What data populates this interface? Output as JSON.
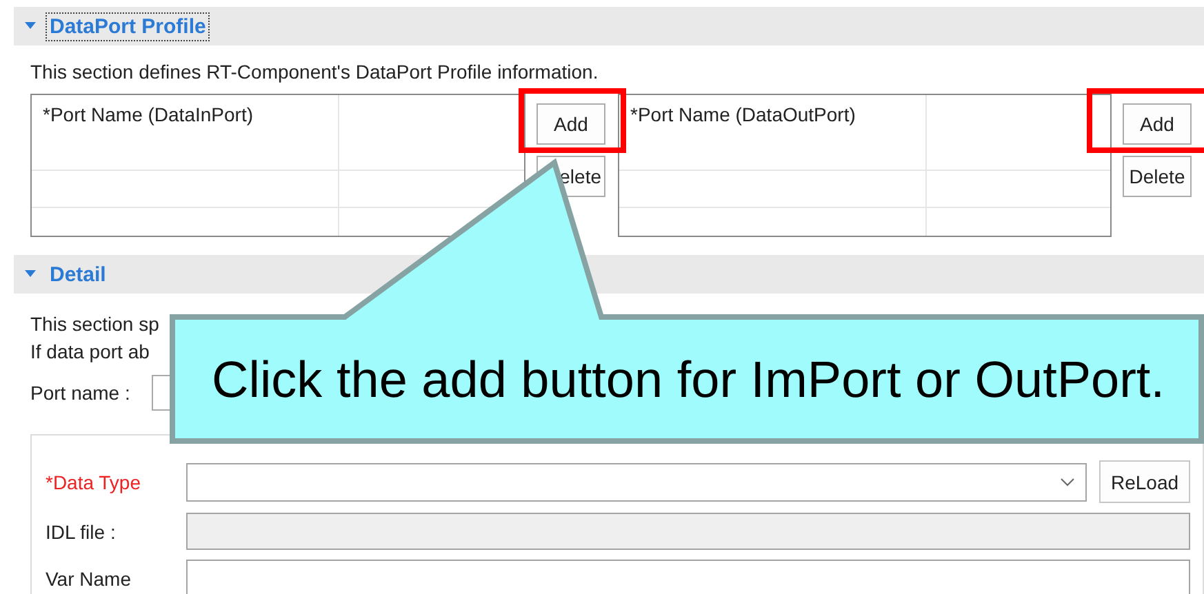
{
  "dataport_section": {
    "title": "DataPort Profile",
    "expanded": true,
    "description": "This section defines RT-Component's DataPort Profile information.",
    "port_tables": [
      {
        "column_1": "*Port Name (DataInPort)",
        "buttons": [
          {
            "label": "Add",
            "highlighted": true
          },
          {
            "label": "elete",
            "highlighted": false
          }
        ]
      },
      {
        "column_1": "*Port Name (DataOutPort)",
        "buttons": [
          {
            "label": "Add",
            "highlighted": true
          },
          {
            "label": "Delete",
            "highlighted": false
          }
        ]
      }
    ]
  },
  "detail_section": {
    "title": "Detail",
    "expanded": true,
    "description_lines": [
      "This section sp",
      "If data port ab"
    ],
    "port_name_label": "Port name :",
    "fields": [
      {
        "label": "*Data Type",
        "required": true,
        "kind": "combo",
        "button": "ReLoad"
      },
      {
        "label": "IDL file :",
        "required": false,
        "kind": "disabled"
      },
      {
        "label": "Var Name",
        "required": false,
        "kind": "text"
      }
    ]
  },
  "callout": {
    "text": "Click the add button for ImPort or OutPort."
  }
}
